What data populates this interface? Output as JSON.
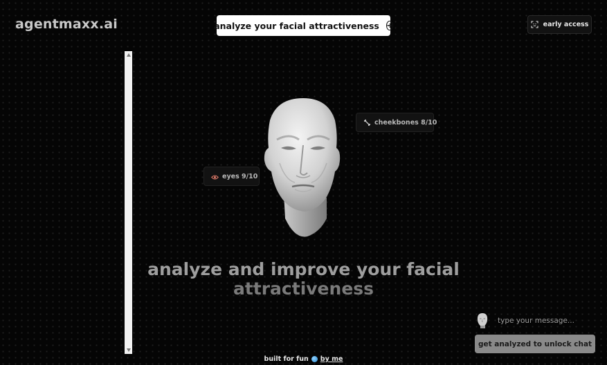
{
  "header": {
    "logo": "agentmaxx.ai",
    "cta_label": "analyze your facial attractiveness",
    "early_access_label": "early access"
  },
  "tags": {
    "cheekbones": "cheekbones 8/10",
    "eyes": "eyes 9/10"
  },
  "hero": {
    "headline_line1": "analyze and improve your facial",
    "headline_line2": "attractiveness"
  },
  "footer": {
    "text": "built for fun",
    "link": "by me"
  },
  "chat": {
    "placeholder": "type your message...",
    "unlock_label": "get analyzed to unlock chat"
  },
  "icons": {
    "cta": "arrow-right-circle-icon",
    "early_access": "scan-face-icon",
    "cheekbones": "bone-icon",
    "eyes": "eye-icon",
    "footer": "globe-icon"
  },
  "colors": {
    "background": "#050505",
    "cta_background": "#ffffff",
    "button_disabled": "#8a8a8a",
    "eye_icon": "#e07b6a"
  }
}
